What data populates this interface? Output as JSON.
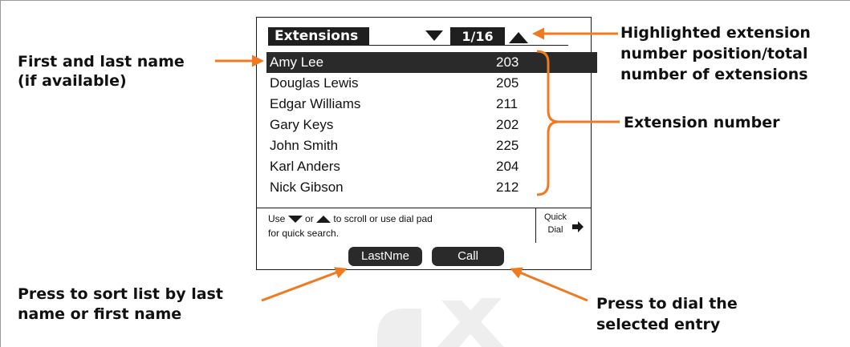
{
  "colors": {
    "accent": "#f07a22",
    "screen_dark": "#1f1f1f",
    "watermark": "#eeeeee"
  },
  "screen": {
    "title": "Extensions",
    "position": "1/16",
    "extensions": [
      {
        "name": "Amy Lee",
        "number": "203",
        "highlighted": true
      },
      {
        "name": "Douglas Lewis",
        "number": "205"
      },
      {
        "name": "Edgar Williams",
        "number": "211"
      },
      {
        "name": "Gary Keys",
        "number": "202"
      },
      {
        "name": "John Smith",
        "number": "225"
      },
      {
        "name": "Karl Anders",
        "number": "204"
      },
      {
        "name": "Nick Gibson",
        "number": "212"
      }
    ],
    "help": {
      "use": "Use",
      "or": "or",
      "to_scroll": "to scroll or use dial pad",
      "line2": "for quick search."
    },
    "quick_dial": {
      "line1": "Quick",
      "line2": "Dial"
    },
    "softkeys": {
      "lastname": "LastNme",
      "call": "Call"
    }
  },
  "callouts": {
    "name": {
      "line1": "First and last name",
      "line2": "(if available)"
    },
    "position": {
      "line1": "Highlighted extension",
      "line2": "number position/total",
      "line3": "number of extensions"
    },
    "extension_number": "Extension number",
    "sort": {
      "line1": "Press to sort list by last",
      "line2": "name or first name"
    },
    "dial": {
      "line1": "Press to dial the",
      "line2": "selected entry"
    }
  }
}
